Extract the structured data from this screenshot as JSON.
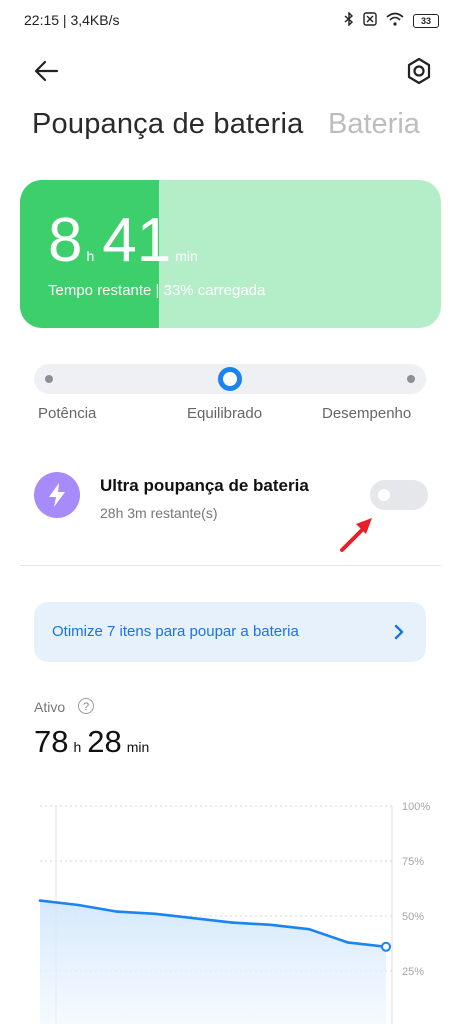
{
  "status_bar": {
    "time_speed": "22:15 | 3,4KB/s",
    "battery_level": "33"
  },
  "header": {
    "back_icon": "arrow-left-icon",
    "settings_icon": "gear-icon"
  },
  "tabs": {
    "active": "Poupança de bateria",
    "inactive": "Bateria"
  },
  "battery_card": {
    "hours": "8",
    "hours_unit": "h",
    "minutes": "41",
    "minutes_unit": "min",
    "subtitle": "Tempo restante | 33% carregada",
    "charge_fraction": 0.33,
    "fill_color": "#3ccf6b",
    "bg_color": "#b4eec8"
  },
  "modes": {
    "labels": [
      "Potência",
      "Equilibrado",
      "Desempenho"
    ],
    "selected_index": 1,
    "accent": "#1a84f0"
  },
  "ultra_saving": {
    "title": "Ultra poupança de bateria",
    "subtitle": "28h 3m restante(s)",
    "enabled": false,
    "icon": "lightning-icon"
  },
  "optimize": {
    "label": "Otimize 7 itens para poupar a bateria",
    "icon": "chevron-right-icon"
  },
  "active": {
    "label": "Ativo",
    "help_icon": "question-icon",
    "help_glyph": "?",
    "hours": "78",
    "hours_unit": "h",
    "minutes": "28",
    "minutes_unit": "min"
  },
  "chart_data": {
    "type": "line",
    "y_ticks": [
      "100%",
      "75%",
      "50%",
      "25%"
    ],
    "ylim": [
      0,
      100
    ],
    "x": [
      0,
      1,
      2,
      3,
      4,
      5,
      6,
      7,
      8,
      9
    ],
    "values": [
      57,
      55,
      52,
      51,
      49,
      47,
      46,
      44,
      38,
      36
    ],
    "line_color": "#1a84f0",
    "grid": true
  }
}
